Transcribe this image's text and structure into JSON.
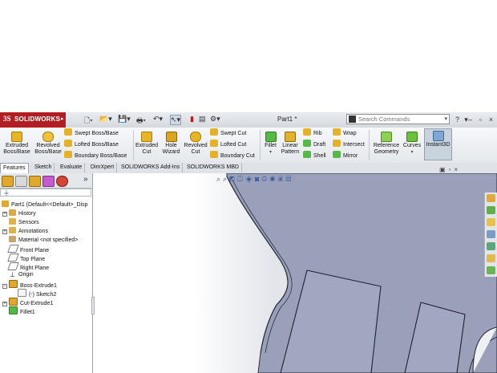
{
  "app": {
    "brand": "SOLIDWORKS",
    "brand_mark": "3S",
    "doc_title": "Part1 *"
  },
  "search": {
    "placeholder": "Search Commands"
  },
  "colors": {
    "brand_red": "#b11d22",
    "part_body": "#9aa0ba",
    "active_button": "#c9d3dd"
  },
  "toolbar": {
    "big_tools": [
      {
        "label1": "Extruded",
        "label2": "Boss/Base",
        "icon": "extruded-boss-icon"
      },
      {
        "label1": "Revolved",
        "label2": "Boss/Base",
        "icon": "revolved-boss-icon"
      },
      {
        "label1": "Extruded",
        "label2": "Cut",
        "icon": "extruded-cut-icon"
      },
      {
        "label1": "Hole",
        "label2": "Wizard",
        "icon": "hole-wizard-icon"
      },
      {
        "label1": "Revolved",
        "label2": "Cut",
        "icon": "revolved-cut-icon"
      },
      {
        "label1": "Fillet",
        "label2": "",
        "icon": "fillet-icon"
      },
      {
        "label1": "Linear",
        "label2": "Pattern",
        "icon": "linear-pattern-icon"
      },
      {
        "label1": "Reference",
        "label2": "Geometry",
        "icon": "reference-geometry-icon"
      },
      {
        "label1": "Curves",
        "label2": "",
        "icon": "curves-icon"
      },
      {
        "label1": "Instant3D",
        "label2": "",
        "icon": "instant3d-icon"
      }
    ],
    "boss_stack": [
      "Swept Boss/Base",
      "Lofted Boss/Base",
      "Boundary Boss/Base"
    ],
    "cut_stack": [
      "Swept Cut",
      "Lofted Cut",
      "Boundary Cut"
    ],
    "feat_col1": [
      "Rib",
      "Draft",
      "Shell"
    ],
    "feat_col2": [
      "Wrap",
      "Intersect",
      "Mirror"
    ]
  },
  "tabs": [
    "Features",
    "Sketch",
    "Evaluate",
    "DimXpert",
    "SOLIDWORKS Add-Ins",
    "SOLIDWORKS MBD"
  ],
  "tree": {
    "root": "Part1  (Default<<Default>_Disp",
    "items": [
      {
        "label": "History",
        "expand": "+"
      },
      {
        "label": "Sensors",
        "expand": ""
      },
      {
        "label": "Annotations",
        "expand": "+"
      },
      {
        "label": "Material <not specified>",
        "expand": ""
      },
      {
        "label": "Front Plane",
        "expand": ""
      },
      {
        "label": "Top Plane",
        "expand": ""
      },
      {
        "label": "Right Plane",
        "expand": ""
      },
      {
        "label": "Origin",
        "expand": ""
      },
      {
        "label": "Boss-Extrude1",
        "expand": "−"
      },
      {
        "label": "(-) Sketch2",
        "expand": ""
      },
      {
        "label": "Cut-Extrude1",
        "expand": "+"
      },
      {
        "label": "Fillet1",
        "expand": ""
      }
    ]
  }
}
